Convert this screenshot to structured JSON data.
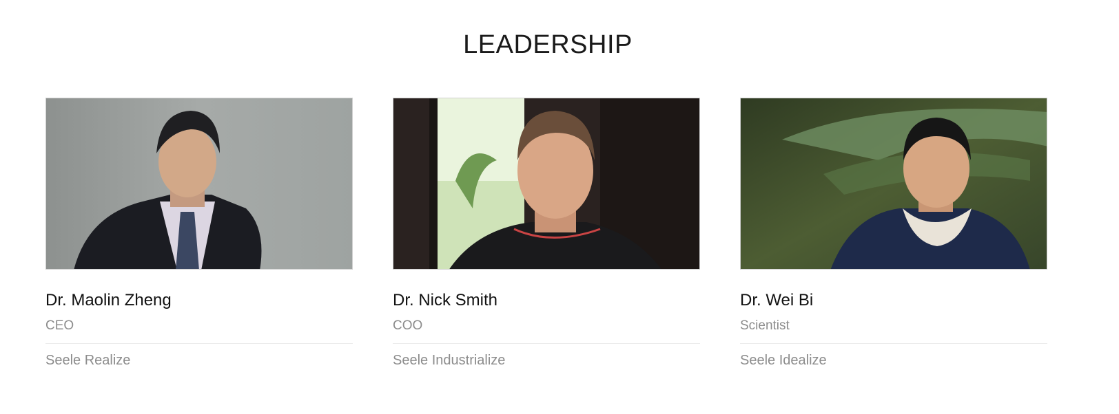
{
  "section": {
    "title": "LEADERSHIP"
  },
  "leaders": [
    {
      "name": "Dr. Maolin Zheng",
      "role": "CEO",
      "company": "Seele Realize",
      "photo": "portrait-photo"
    },
    {
      "name": "Dr. Nick Smith",
      "role": "COO",
      "company": "Seele Industrialize",
      "photo": "portrait-photo"
    },
    {
      "name": "Dr. Wei Bi",
      "role": "Scientist",
      "company": "Seele Idealize",
      "photo": "portrait-photo"
    }
  ],
  "colors": {
    "heading": "#1a1a1a",
    "name": "#111111",
    "muted": "#8c8c8c",
    "divider": "#ececec"
  }
}
